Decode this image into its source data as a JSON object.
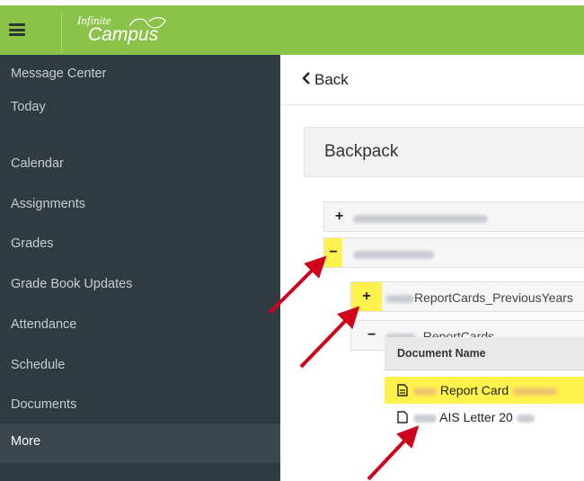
{
  "app": {
    "logo_line1": "Infinite",
    "logo_line2": "Campus",
    "brand_color": "#8bc34a",
    "sidebar_color": "#2f3a41"
  },
  "sidebar": {
    "items": [
      {
        "label": "Message Center"
      },
      {
        "label": "Today"
      },
      {
        "label": "Calendar"
      },
      {
        "label": "Assignments"
      },
      {
        "label": "Grades"
      },
      {
        "label": "Grade Book Updates"
      },
      {
        "label": "Attendance"
      },
      {
        "label": "Schedule"
      },
      {
        "label": "Documents"
      },
      {
        "label": "More"
      }
    ]
  },
  "main": {
    "back_label": "Back",
    "title": "Backpack",
    "tree": [
      {
        "toggle": "+"
      },
      {
        "toggle": "−"
      },
      {
        "toggle": "+",
        "label": "ReportCards_PreviousYears"
      },
      {
        "toggle": "−",
        "label": "_ReportCards"
      }
    ],
    "documents": {
      "header": "Document Name",
      "rows": [
        {
          "label": "Report Card",
          "highlight": true
        },
        {
          "label": "AIS Letter 20"
        }
      ]
    }
  },
  "annotations": {
    "highlight_color": "#fff24d",
    "arrow_color": "#d0021b"
  }
}
